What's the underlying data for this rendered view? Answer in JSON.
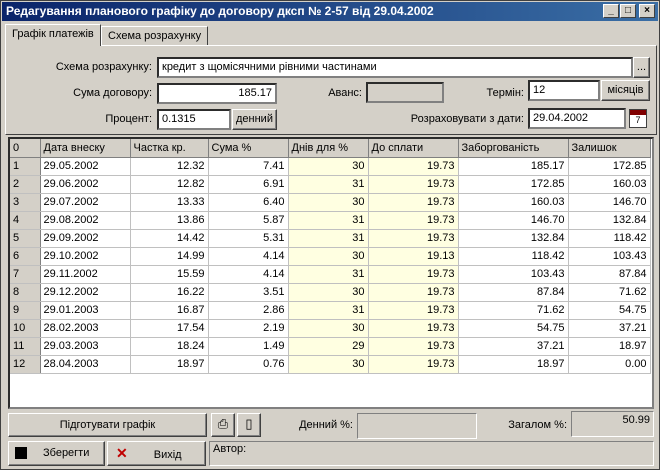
{
  "window": {
    "title": "Редагування планового графіку до договору дксп № 2-57 від 29.04.2002"
  },
  "tabs": [
    "Графік платежів",
    "Схема розрахунку"
  ],
  "form": {
    "scheme_label": "Схема розрахунку:",
    "scheme_value": "кредит з щомісячними рівними частинами",
    "sum_label": "Сума договору:",
    "sum_value": "185.17",
    "advance_label": "Аванс:",
    "advance_value": "",
    "term_label": "Термін:",
    "term_value": "12",
    "term_unit": "місяців",
    "percent_label": "Процент:",
    "percent_value": "0.1315",
    "percent_unit": "денний",
    "calc_from_label": "Розраховувати з дати:",
    "calc_from_value": "29.04.2002"
  },
  "table": {
    "columns": [
      "0",
      "Дата внеску",
      "Частка кр.",
      "Сума %",
      "Днів для %",
      "До сплати",
      "Заборгованість",
      "Залишок"
    ],
    "rows": [
      [
        "1",
        "29.05.2002",
        "12.32",
        "7.41",
        "30",
        "19.73",
        "185.17",
        "172.85"
      ],
      [
        "2",
        "29.06.2002",
        "12.82",
        "6.91",
        "31",
        "19.73",
        "172.85",
        "160.03"
      ],
      [
        "3",
        "29.07.2002",
        "13.33",
        "6.40",
        "30",
        "19.73",
        "160.03",
        "146.70"
      ],
      [
        "4",
        "29.08.2002",
        "13.86",
        "5.87",
        "31",
        "19.73",
        "146.70",
        "132.84"
      ],
      [
        "5",
        "29.09.2002",
        "14.42",
        "5.31",
        "31",
        "19.73",
        "132.84",
        "118.42"
      ],
      [
        "6",
        "29.10.2002",
        "14.99",
        "4.14",
        "30",
        "19.13",
        "118.42",
        "103.43"
      ],
      [
        "7",
        "29.11.2002",
        "15.59",
        "4.14",
        "31",
        "19.73",
        "103.43",
        "87.84"
      ],
      [
        "8",
        "29.12.2002",
        "16.22",
        "3.51",
        "30",
        "19.73",
        "87.84",
        "71.62"
      ],
      [
        "9",
        "29.01.2003",
        "16.87",
        "2.86",
        "31",
        "19.73",
        "71.62",
        "54.75"
      ],
      [
        "10",
        "28.02.2003",
        "17.54",
        "2.19",
        "30",
        "19.73",
        "54.75",
        "37.21"
      ],
      [
        "11",
        "29.03.2003",
        "18.24",
        "1.49",
        "29",
        "19.73",
        "37.21",
        "18.97"
      ],
      [
        "12",
        "28.04.2003",
        "18.97",
        "0.76",
        "30",
        "19.73",
        "18.97",
        "0.00"
      ]
    ]
  },
  "bottom": {
    "prepare_label": "Підготувати графік",
    "daily_label": "Денний %:",
    "daily_value": "",
    "total_label": "Загалом %:",
    "total_value": "50.99",
    "save_label": "Зберегти",
    "exit_label": "Вихід",
    "author_label": "Автор:"
  }
}
